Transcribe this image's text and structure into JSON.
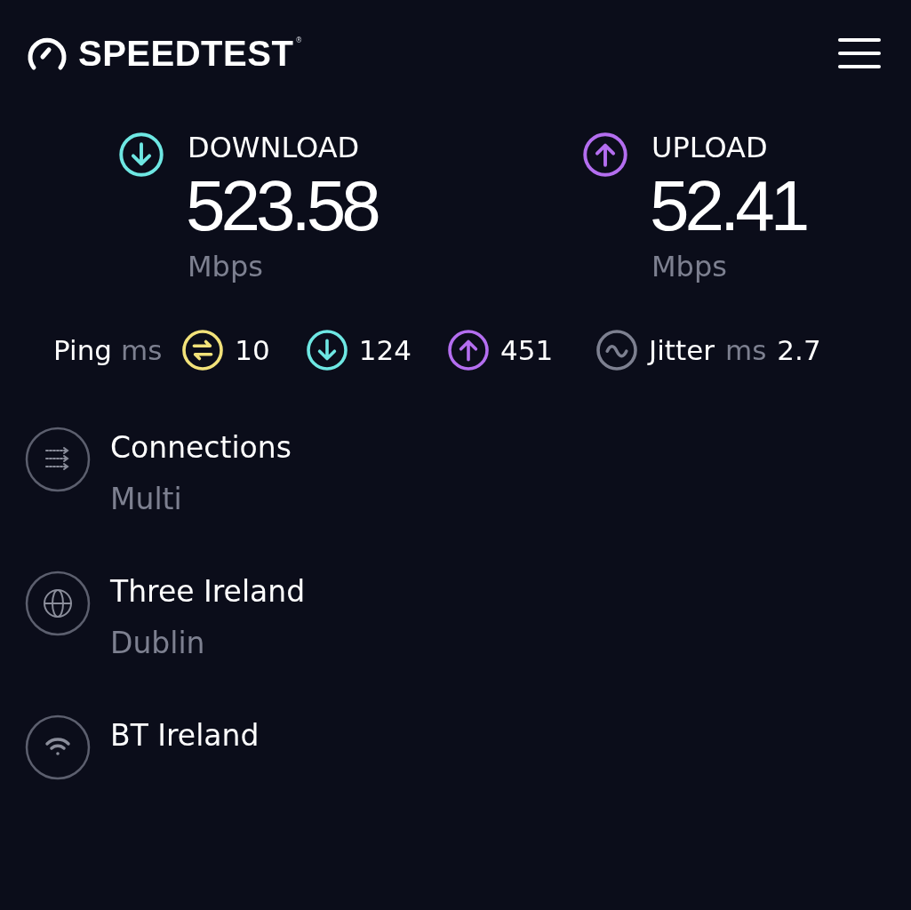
{
  "header": {
    "logo_text": "SPEEDTEST",
    "registered_mark": "®"
  },
  "results": [
    {
      "kind": "download",
      "label": "DOWNLOAD",
      "value": "523.58",
      "unit": "Mbps"
    },
    {
      "kind": "upload",
      "label": "UPLOAD",
      "value": "52.41",
      "unit": "Mbps"
    }
  ],
  "ping": {
    "label": "Ping",
    "unit": "ms",
    "items": [
      {
        "kind": "idle",
        "value": "10"
      },
      {
        "kind": "download",
        "value": "124"
      },
      {
        "kind": "upload",
        "value": "451"
      }
    ]
  },
  "jitter": {
    "label": "Jitter",
    "unit": "ms",
    "value": "2.7"
  },
  "details": [
    {
      "kind": "connections",
      "title": "Connections",
      "subtitle": "Multi"
    },
    {
      "kind": "server",
      "title": "Three Ireland",
      "subtitle": "Dublin"
    },
    {
      "kind": "provider",
      "title": "BT Ireland"
    }
  ]
}
